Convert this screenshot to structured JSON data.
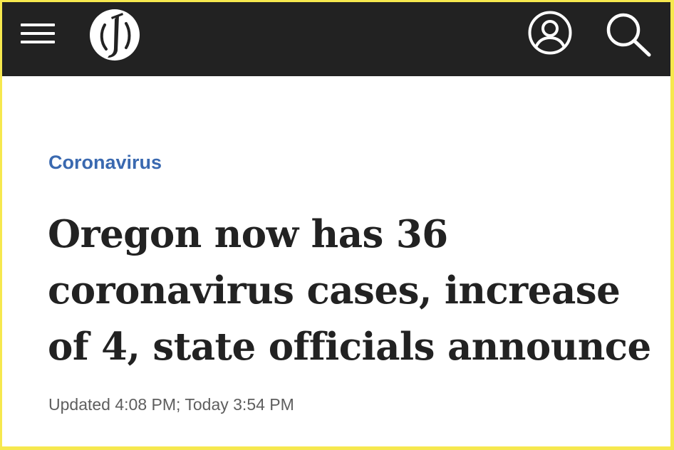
{
  "header": {
    "menu_icon": "hamburger-menu-icon",
    "logo_icon": "oregonian-o-logo",
    "account_icon": "user-account-icon",
    "search_icon": "search-magnifier-icon",
    "background_color": "#222222"
  },
  "article": {
    "section": "Coronavirus",
    "section_color": "#3a69b0",
    "headline_lines": [
      "Oregon now has 36",
      "coronavirus cases, increase",
      "of 4, state officials announce"
    ],
    "timestamp": "Updated 4:08 PM; Today 3:54 PM"
  },
  "page": {
    "border_color": "#f6e84e"
  }
}
